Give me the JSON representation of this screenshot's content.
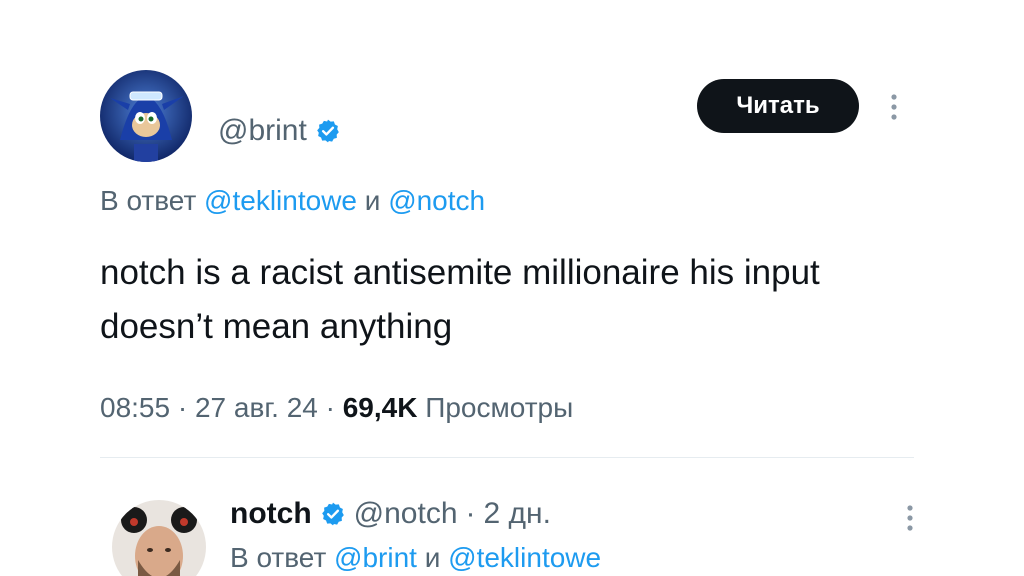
{
  "main_tweet": {
    "handle": "@brint",
    "follow_label": "Читать",
    "reply_prefix": "В ответ",
    "reply_mention_1": "@teklintowe",
    "reply_conjunction": "и",
    "reply_mention_2": "@notch",
    "text": "notch is a racist antisemite millionaire his input doesn’t mean anything",
    "time": "08:55",
    "date": "27 авг. 24",
    "views_count": "69,4K",
    "views_label": "Просмотры"
  },
  "reply_tweet": {
    "name": "notch",
    "handle": "@notch",
    "age": "2 дн.",
    "reply_prefix": "В ответ",
    "reply_mention_1": "@brint",
    "reply_conjunction": "и",
    "reply_mention_2": "@teklintowe"
  },
  "colors": {
    "accent": "#1d9bf0",
    "secondary_text": "#536471",
    "primary_text": "#0f1419",
    "button_bg": "#0f1419"
  },
  "icons": {
    "verified": "verified-badge-icon",
    "more": "more-vertical-icon"
  }
}
